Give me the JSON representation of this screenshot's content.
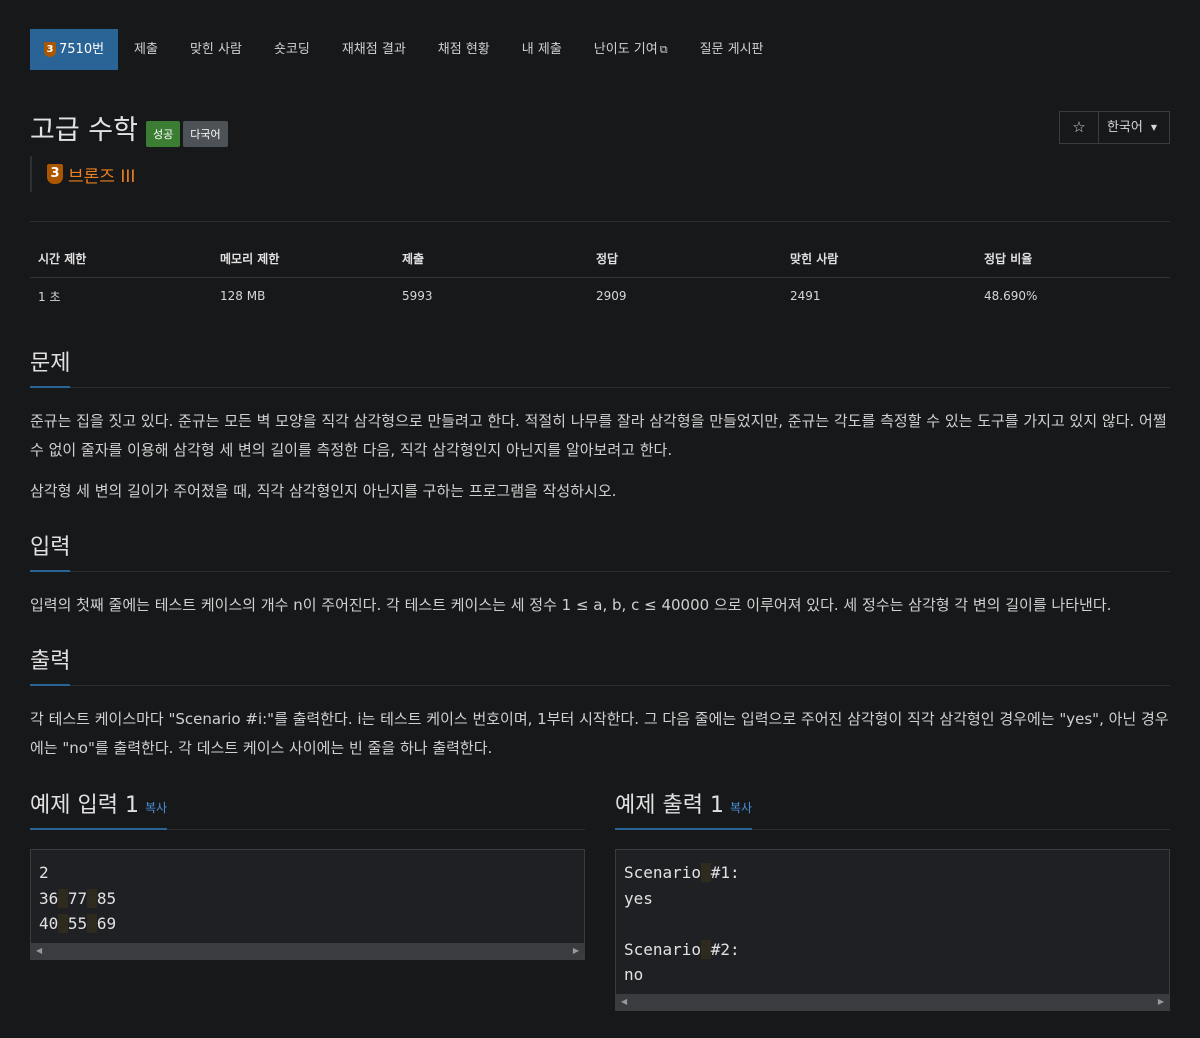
{
  "nav": {
    "problem_tab": {
      "tier_num": "3",
      "label": "7510번"
    },
    "tabs": [
      "제출",
      "맞힌 사람",
      "숏코딩",
      "재채점 결과",
      "채점 현황",
      "내 제출",
      "난이도 기여",
      "질문 게시판"
    ]
  },
  "problem": {
    "title": "고급 수학",
    "labels": {
      "success": "성공",
      "multilang": "다국어"
    },
    "tier": {
      "num": "3",
      "name": "브론즈 III",
      "color": "#ee7f20"
    }
  },
  "actions": {
    "language": "한국어"
  },
  "stats": {
    "headers": [
      "시간 제한",
      "메모리 제한",
      "제출",
      "정답",
      "맞힌 사람",
      "정답 비율"
    ],
    "values": [
      "1 초",
      "128 MB",
      "5993",
      "2909",
      "2491",
      "48.690%"
    ]
  },
  "sections": {
    "problem": {
      "title": "문제",
      "p1": "준규는 집을 짓고 있다. 준규는 모든 벽 모양을 직각 삼각형으로 만들려고 한다. 적절히 나무를 잘라 삼각형을 만들었지만, 준규는 각도를 측정할 수 있는 도구를 가지고 있지 않다. 어쩔 수 없이 줄자를 이용해 삼각형 세 변의 길이를 측정한 다음, 직각 삼각형인지 아닌지를 알아보려고 한다.",
      "p2": "삼각형 세 변의 길이가 주어졌을 때, 직각 삼각형인지 아닌지를 구하는 프로그램을 작성하시오."
    },
    "input": {
      "title": "입력",
      "p1": "입력의 첫째 줄에는 테스트 케이스의 개수 n이 주어진다. 각 테스트 케이스는 세 정수 1 ≤ a, b, c ≤ 40000 으로 이루어져 있다. 세 정수는 삼각형 각 변의 길이를 나타낸다."
    },
    "output": {
      "title": "출력",
      "p1": "각 테스트 케이스마다 \"Scenario #i:\"를 출력한다. i는 테스트 케이스 번호이며, 1부터 시작한다. 그 다음 줄에는 입력으로 주어진 삼각형이 직각 삼각형인 경우에는 \"yes\", 아닌 경우에는 \"no\"를 출력한다. 각 데스트 케이스 사이에는 빈 줄을 하나 출력한다."
    }
  },
  "samples": {
    "copy_label": "복사",
    "input": {
      "title": "예제 입력 1",
      "lines": [
        "2",
        "36 77 85",
        "40 55 69"
      ]
    },
    "output": {
      "title": "예제 출력 1",
      "lines": [
        "Scenario #1:",
        "yes",
        "",
        "Scenario #2:",
        "no"
      ]
    }
  },
  "colors": {
    "accent": "#2a6496",
    "bronze": "#ad5600",
    "success": "#3b7d33",
    "link": "#4a90d9"
  }
}
